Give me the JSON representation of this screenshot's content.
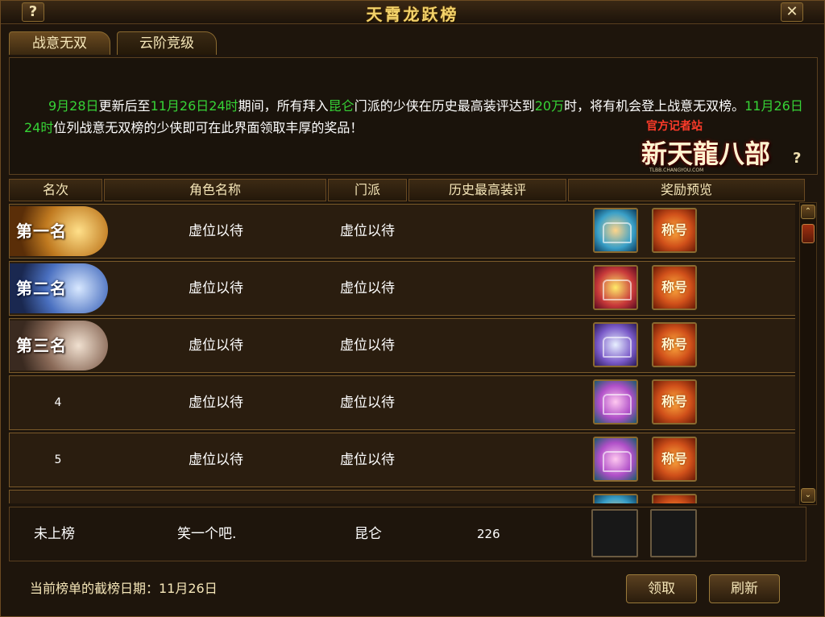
{
  "window": {
    "title": "天霄龙跃榜",
    "help_label": "?",
    "close_label": "✕"
  },
  "tabs": [
    {
      "label": "战意无双",
      "active": true
    },
    {
      "label": "云阶竞级",
      "active": false
    }
  ],
  "info": {
    "p1": "9月28日",
    "p2": "更新后至",
    "p3": "11月26日24时",
    "p4": "期间，所有拜入",
    "p5": "昆仑",
    "p6": "门派的少侠在历史最高装评达到",
    "p7": "20万",
    "p8": "时，将有机会登上战意无双榜。",
    "p9": "11月26日24时",
    "p10": "位列战意无双榜的少侠即可在此界面领取丰厚的奖品！"
  },
  "logo": {
    "sub": "官方记者站",
    "main": "新天龍八部",
    "url": "TLBB.CHANGYOU.COM"
  },
  "help_label": "?",
  "headers": [
    "名次",
    "角色名称",
    "门派",
    "历史最高装评",
    "奖励预览"
  ],
  "rows": [
    {
      "rank": "第一名",
      "name": "虚位以待",
      "sect": "虚位以待",
      "score": "",
      "reward_title": "称号"
    },
    {
      "rank": "第二名",
      "name": "虚位以待",
      "sect": "虚位以待",
      "score": "",
      "reward_title": "称号"
    },
    {
      "rank": "第三名",
      "name": "虚位以待",
      "sect": "虚位以待",
      "score": "",
      "reward_title": "称号"
    },
    {
      "rank": "4",
      "name": "虚位以待",
      "sect": "虚位以待",
      "score": "",
      "reward_title": "称号"
    },
    {
      "rank": "5",
      "name": "虚位以待",
      "sect": "虚位以待",
      "score": "",
      "reward_title": "称号"
    }
  ],
  "self": {
    "rank": "未上榜",
    "name": "笑一个吧.",
    "sect": "昆仑",
    "score": "226"
  },
  "deadline": "当前榜单的截榜日期：11月26日",
  "buttons": {
    "claim": "领取",
    "refresh": "刷新"
  },
  "scroll": {
    "up": "⌃",
    "down": "⌄"
  }
}
